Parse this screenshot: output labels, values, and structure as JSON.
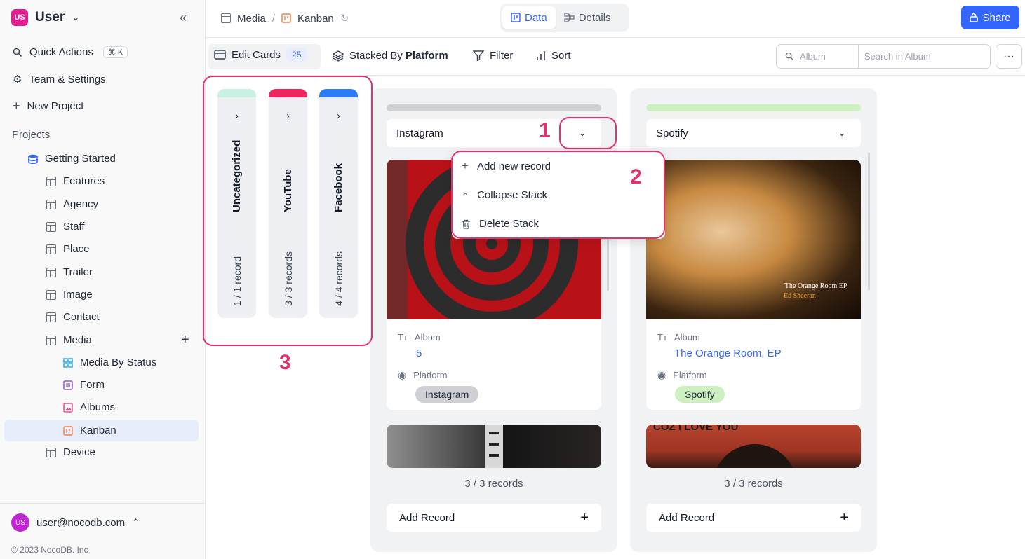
{
  "workspace": {
    "avatar": "US",
    "name": "User"
  },
  "sidebar": {
    "quick_actions": "Quick Actions",
    "shortcut": "⌘ K",
    "team_settings": "Team & Settings",
    "new_project": "New Project",
    "projects_label": "Projects",
    "project": "Getting Started",
    "tables": [
      "Features",
      "Agency",
      "Staff",
      "Place",
      "Trailer",
      "Image",
      "Contact",
      "Media"
    ],
    "views": [
      "Media By Status",
      "Form",
      "Albums",
      "Kanban"
    ],
    "last_table": "Device",
    "user_email": "user@nocodb.com",
    "user_avatar": "US",
    "copyright": "© 2023 NocoDB. Inc"
  },
  "topbar": {
    "crumb_table": "Media",
    "crumb_view": "Kanban",
    "tab_data": "Data",
    "tab_details": "Details",
    "share": "Share"
  },
  "toolbar": {
    "edit_cards": "Edit Cards",
    "edit_cards_count": "25",
    "stacked_by": "Stacked By",
    "stacked_field": "Platform",
    "filter": "Filter",
    "sort": "Sort",
    "search_field": "Album",
    "search_placeholder": "Search in Album"
  },
  "collapsed_stacks": [
    {
      "name": "Uncategorized",
      "records": "1 / 1 record",
      "color": "#c8f0e3"
    },
    {
      "name": "YouTube",
      "records": "3 / 3 records",
      "color": "#f0245e"
    },
    {
      "name": "Facebook",
      "records": "4 / 4 records",
      "color": "#2b7cf6"
    }
  ],
  "stacks": [
    {
      "name": "Instagram",
      "header_color": "#cfd0d3",
      "card_album_label": "Album",
      "card_album_value": "5",
      "card_platform_label": "Platform",
      "card_platform_value": "Instagram",
      "tag_color": "#cfd0d3",
      "count": "3 / 3 records",
      "add": "Add Record"
    },
    {
      "name": "Spotify",
      "header_color": "#cdf0c0",
      "card_album_label": "Album",
      "card_album_value": "The Orange Room, EP",
      "card_platform_label": "Platform",
      "card_platform_value": "Spotify",
      "tag_color": "#cdf0c0",
      "cover_text_1": "'The Orange Room EP",
      "cover_text_2": "Ed Sheeran",
      "cover2_text": "COZ I LOVE YOU",
      "count": "3 / 3 records",
      "add": "Add Record"
    }
  ],
  "stack_menu": {
    "add": "Add new record",
    "collapse": "Collapse Stack",
    "delete": "Delete Stack"
  },
  "annotations": {
    "n1": "1",
    "n2": "2",
    "n3": "3",
    "color": "#e5306e"
  }
}
